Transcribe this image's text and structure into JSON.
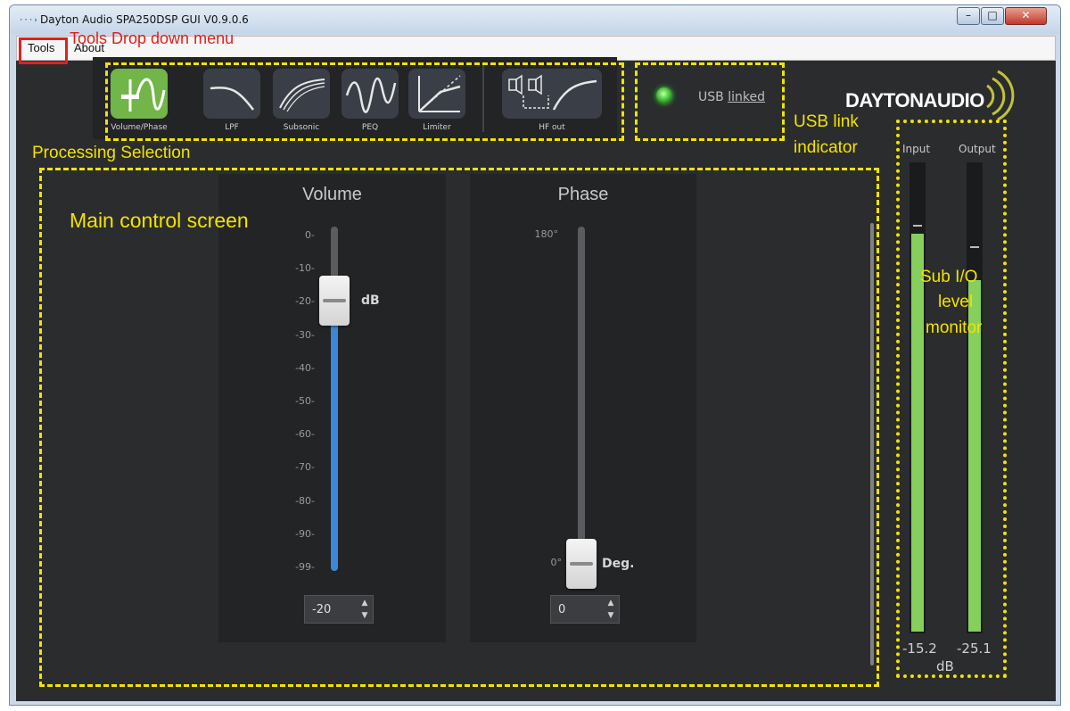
{
  "window": {
    "title": "Dayton Audio SPA250DSP GUI V0.9.0.6",
    "minimize": "–",
    "maximize": "□",
    "close": "✕"
  },
  "menu": [
    {
      "label": "Tools"
    },
    {
      "label": "About"
    }
  ],
  "toolbar": {
    "buttons": [
      {
        "label": "Volume/Phase",
        "icon": "volume-phase-icon",
        "active": true
      },
      {
        "label": "LPF",
        "icon": "lpf-curve-icon",
        "active": false
      },
      {
        "label": "Subsonic",
        "icon": "subsonic-curve-icon",
        "active": false
      },
      {
        "label": "PEQ",
        "icon": "peq-curve-icon",
        "active": false
      },
      {
        "label": "Limiter",
        "icon": "limiter-curve-icon",
        "active": false
      },
      {
        "label": "HF out",
        "icon": "hf-out-icon",
        "active": false
      }
    ]
  },
  "usb": {
    "prefix": "USB",
    "status": "linked",
    "led_color": "#58d84a"
  },
  "logo": {
    "text": "DAYTONAUDIO"
  },
  "volume": {
    "title": "Volume",
    "ticks": [
      "0-",
      "-10-",
      "-20-",
      "-30-",
      "-40-",
      "-50-",
      "-60-",
      "-70-",
      "-80-",
      "-90-",
      "-99-"
    ],
    "unit": "dB",
    "value": "-20",
    "level_db": -20,
    "fill_color": "#3c87d6"
  },
  "phase": {
    "title": "Phase",
    "top_label": "180°",
    "bottom_label": "0°",
    "unit": "Deg.",
    "value": "0",
    "level_deg": 0
  },
  "meters": {
    "input": {
      "label": "Input",
      "value": "-15.2",
      "level_db": -15.2
    },
    "output": {
      "label": "Output",
      "value": "-25.1",
      "level_db": -25.1
    },
    "unit": "dB",
    "fill_color": "#86cf5d"
  },
  "annotations": {
    "tools_menu": "Tools Drop down menu",
    "processing": "Processing Selection",
    "usb_line1": "USB link",
    "usb_line2": "indicator",
    "main": "Main control screen",
    "sub_line1": "Sub  I/O",
    "sub_line2": "level",
    "sub_line3": "monitor",
    "highlight_color": "#f2e200",
    "tools_color": "#e02020"
  }
}
